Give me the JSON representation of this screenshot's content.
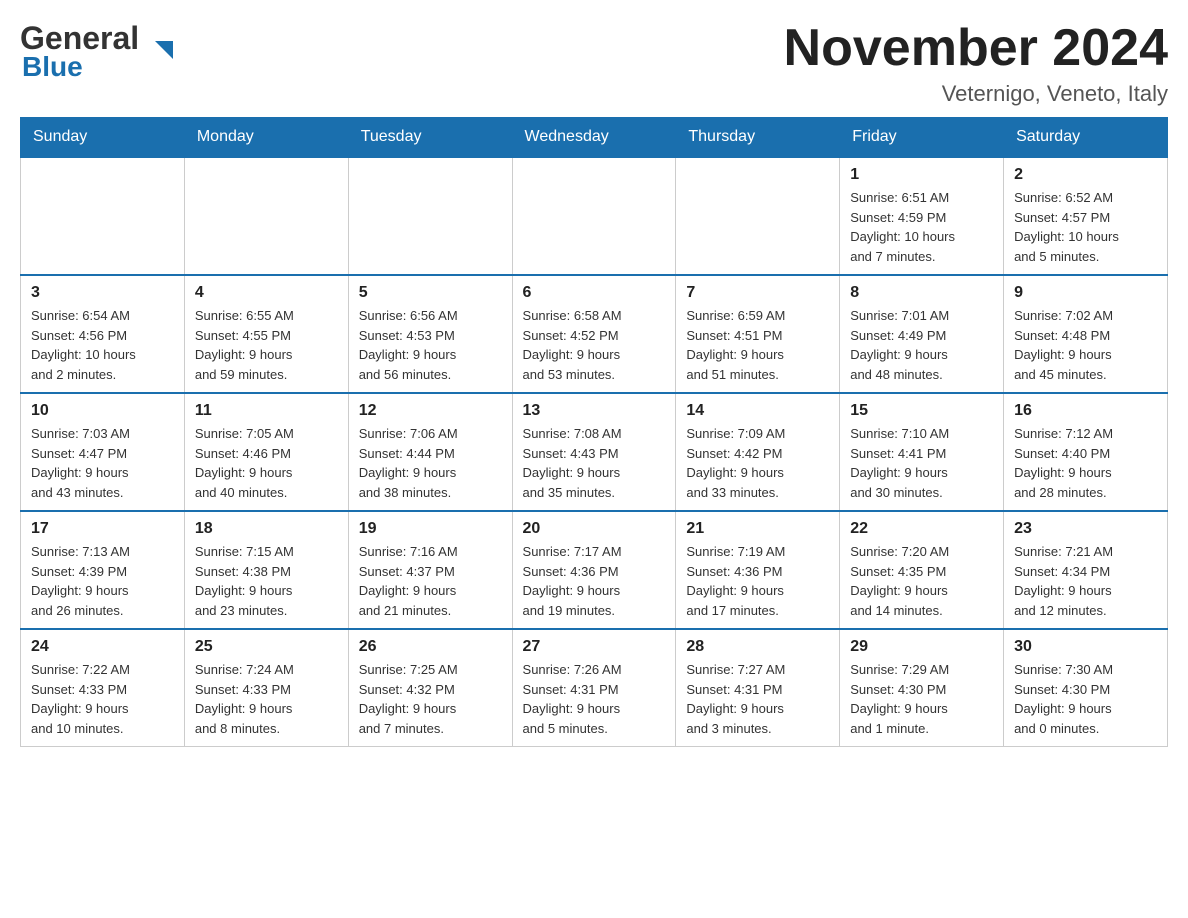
{
  "header": {
    "logo_general": "General",
    "logo_blue": "Blue",
    "title": "November 2024",
    "location": "Veternigo, Veneto, Italy"
  },
  "weekdays": [
    "Sunday",
    "Monday",
    "Tuesday",
    "Wednesday",
    "Thursday",
    "Friday",
    "Saturday"
  ],
  "weeks": [
    [
      {
        "day": "",
        "info": ""
      },
      {
        "day": "",
        "info": ""
      },
      {
        "day": "",
        "info": ""
      },
      {
        "day": "",
        "info": ""
      },
      {
        "day": "",
        "info": ""
      },
      {
        "day": "1",
        "info": "Sunrise: 6:51 AM\nSunset: 4:59 PM\nDaylight: 10 hours\nand 7 minutes."
      },
      {
        "day": "2",
        "info": "Sunrise: 6:52 AM\nSunset: 4:57 PM\nDaylight: 10 hours\nand 5 minutes."
      }
    ],
    [
      {
        "day": "3",
        "info": "Sunrise: 6:54 AM\nSunset: 4:56 PM\nDaylight: 10 hours\nand 2 minutes."
      },
      {
        "day": "4",
        "info": "Sunrise: 6:55 AM\nSunset: 4:55 PM\nDaylight: 9 hours\nand 59 minutes."
      },
      {
        "day": "5",
        "info": "Sunrise: 6:56 AM\nSunset: 4:53 PM\nDaylight: 9 hours\nand 56 minutes."
      },
      {
        "day": "6",
        "info": "Sunrise: 6:58 AM\nSunset: 4:52 PM\nDaylight: 9 hours\nand 53 minutes."
      },
      {
        "day": "7",
        "info": "Sunrise: 6:59 AM\nSunset: 4:51 PM\nDaylight: 9 hours\nand 51 minutes."
      },
      {
        "day": "8",
        "info": "Sunrise: 7:01 AM\nSunset: 4:49 PM\nDaylight: 9 hours\nand 48 minutes."
      },
      {
        "day": "9",
        "info": "Sunrise: 7:02 AM\nSunset: 4:48 PM\nDaylight: 9 hours\nand 45 minutes."
      }
    ],
    [
      {
        "day": "10",
        "info": "Sunrise: 7:03 AM\nSunset: 4:47 PM\nDaylight: 9 hours\nand 43 minutes."
      },
      {
        "day": "11",
        "info": "Sunrise: 7:05 AM\nSunset: 4:46 PM\nDaylight: 9 hours\nand 40 minutes."
      },
      {
        "day": "12",
        "info": "Sunrise: 7:06 AM\nSunset: 4:44 PM\nDaylight: 9 hours\nand 38 minutes."
      },
      {
        "day": "13",
        "info": "Sunrise: 7:08 AM\nSunset: 4:43 PM\nDaylight: 9 hours\nand 35 minutes."
      },
      {
        "day": "14",
        "info": "Sunrise: 7:09 AM\nSunset: 4:42 PM\nDaylight: 9 hours\nand 33 minutes."
      },
      {
        "day": "15",
        "info": "Sunrise: 7:10 AM\nSunset: 4:41 PM\nDaylight: 9 hours\nand 30 minutes."
      },
      {
        "day": "16",
        "info": "Sunrise: 7:12 AM\nSunset: 4:40 PM\nDaylight: 9 hours\nand 28 minutes."
      }
    ],
    [
      {
        "day": "17",
        "info": "Sunrise: 7:13 AM\nSunset: 4:39 PM\nDaylight: 9 hours\nand 26 minutes."
      },
      {
        "day": "18",
        "info": "Sunrise: 7:15 AM\nSunset: 4:38 PM\nDaylight: 9 hours\nand 23 minutes."
      },
      {
        "day": "19",
        "info": "Sunrise: 7:16 AM\nSunset: 4:37 PM\nDaylight: 9 hours\nand 21 minutes."
      },
      {
        "day": "20",
        "info": "Sunrise: 7:17 AM\nSunset: 4:36 PM\nDaylight: 9 hours\nand 19 minutes."
      },
      {
        "day": "21",
        "info": "Sunrise: 7:19 AM\nSunset: 4:36 PM\nDaylight: 9 hours\nand 17 minutes."
      },
      {
        "day": "22",
        "info": "Sunrise: 7:20 AM\nSunset: 4:35 PM\nDaylight: 9 hours\nand 14 minutes."
      },
      {
        "day": "23",
        "info": "Sunrise: 7:21 AM\nSunset: 4:34 PM\nDaylight: 9 hours\nand 12 minutes."
      }
    ],
    [
      {
        "day": "24",
        "info": "Sunrise: 7:22 AM\nSunset: 4:33 PM\nDaylight: 9 hours\nand 10 minutes."
      },
      {
        "day": "25",
        "info": "Sunrise: 7:24 AM\nSunset: 4:33 PM\nDaylight: 9 hours\nand 8 minutes."
      },
      {
        "day": "26",
        "info": "Sunrise: 7:25 AM\nSunset: 4:32 PM\nDaylight: 9 hours\nand 7 minutes."
      },
      {
        "day": "27",
        "info": "Sunrise: 7:26 AM\nSunset: 4:31 PM\nDaylight: 9 hours\nand 5 minutes."
      },
      {
        "day": "28",
        "info": "Sunrise: 7:27 AM\nSunset: 4:31 PM\nDaylight: 9 hours\nand 3 minutes."
      },
      {
        "day": "29",
        "info": "Sunrise: 7:29 AM\nSunset: 4:30 PM\nDaylight: 9 hours\nand 1 minute."
      },
      {
        "day": "30",
        "info": "Sunrise: 7:30 AM\nSunset: 4:30 PM\nDaylight: 9 hours\nand 0 minutes."
      }
    ]
  ]
}
